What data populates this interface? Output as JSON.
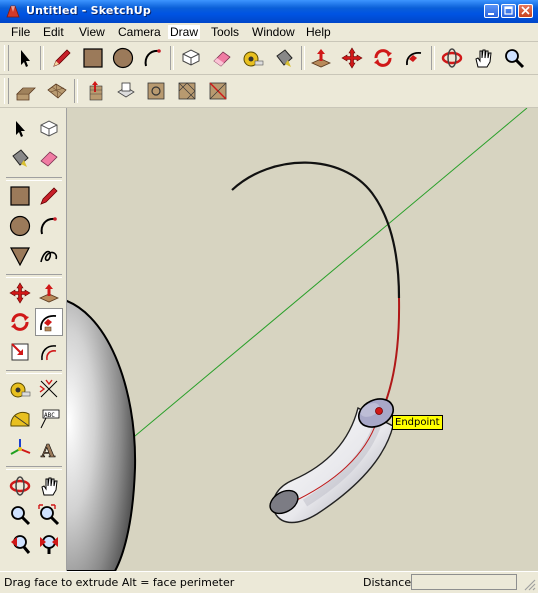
{
  "window": {
    "title": "Untitled - SketchUp"
  },
  "menu": [
    "File",
    "Edit",
    "View",
    "Camera",
    "Draw",
    "Tools",
    "Window",
    "Help"
  ],
  "menu_active": "Draw",
  "toolbar_main": [
    "select-tool",
    "pencil-tool",
    "rectangle-tool",
    "circle-tool",
    "arc-tool",
    "eraser-tool",
    "paint-bucket-tool",
    "tape-measure-tool",
    "push-pull-tool",
    "move-tool",
    "rotate-tool",
    "follow-me-tool",
    "orbit-tool",
    "pan-tool",
    "zoom-tool"
  ],
  "toolbar_views": [
    "sandbox-terrain-tool",
    "sandbox-stamp-tool",
    "add-detail-tool",
    "smoove-tool",
    "drape-tool",
    "flip-edge-tool"
  ],
  "tooltip": {
    "text": "Endpoint"
  },
  "status": {
    "hint": "Drag face to extrude  Alt = face perimeter",
    "measurement_label": "Distance",
    "measurement_value": ""
  }
}
